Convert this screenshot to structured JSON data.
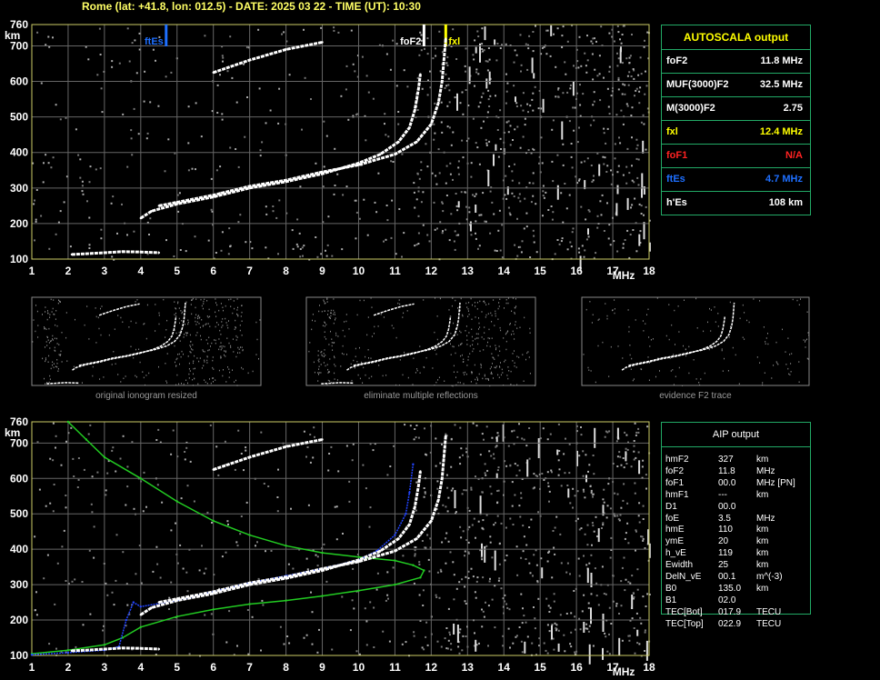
{
  "header": "Rome (lat: +41.8, lon: 012.5) - DATE: 2025 03 22 - TIME (UT): 10:30",
  "chart_data": [
    {
      "type": "scatter",
      "title": "",
      "xlabel": "MHz",
      "ylabel": "km",
      "xlim": [
        1,
        18
      ],
      "ylim": [
        100,
        760
      ],
      "xticks": [
        "1",
        "2",
        "3",
        "4",
        "5",
        "6",
        "7",
        "8",
        "9",
        "10",
        "11",
        "12",
        "13",
        "14",
        "15",
        "16",
        "17",
        "18"
      ],
      "yticks": [
        "100",
        "200",
        "300",
        "400",
        "500",
        "600",
        "700",
        "760"
      ],
      "grid": true,
      "markers": [
        {
          "name": "ftEs",
          "x": 4.7,
          "color": "#1e6fff"
        },
        {
          "name": "foF2",
          "x": 11.8,
          "color": "#ffffff"
        },
        {
          "name": "fxl",
          "x": 12.4,
          "color": "#ffff00"
        }
      ],
      "series": [
        {
          "points": [
            [
              4.0,
              215
            ],
            [
              4.3,
              235
            ],
            [
              5,
              255
            ],
            [
              6,
              275
            ],
            [
              7,
              300
            ],
            [
              8,
              318
            ],
            [
              9,
              340
            ],
            [
              10,
              370
            ],
            [
              10.6,
              395
            ],
            [
              11.1,
              430
            ],
            [
              11.4,
              470
            ],
            [
              11.55,
              520
            ],
            [
              11.65,
              580
            ],
            [
              11.7,
              620
            ]
          ]
        },
        {
          "points": [
            [
              4.5,
              250
            ],
            [
              5,
              260
            ],
            [
              6,
              280
            ],
            [
              7,
              305
            ],
            [
              8,
              322
            ],
            [
              9,
              345
            ],
            [
              10,
              365
            ],
            [
              11,
              395
            ],
            [
              11.6,
              430
            ],
            [
              12,
              480
            ],
            [
              12.2,
              540
            ],
            [
              12.3,
              600
            ],
            [
              12.35,
              660
            ],
            [
              12.4,
              720
            ]
          ]
        },
        {
          "points": [
            [
              2.1,
              113
            ],
            [
              2.5,
              115
            ],
            [
              3,
              118
            ],
            [
              3.5,
              121
            ],
            [
              4,
              120
            ],
            [
              4.5,
              118
            ]
          ]
        },
        {
          "points": [
            [
              6,
              625
            ],
            [
              7,
              660
            ],
            [
              8,
              690
            ],
            [
              9,
              710
            ]
          ]
        }
      ]
    },
    {
      "type": "line",
      "title": "",
      "xlabel": "MHz",
      "ylabel": "km",
      "xlim": [
        1,
        18
      ],
      "ylim": [
        100,
        760
      ],
      "xticks": [
        "1",
        "2",
        "3",
        "4",
        "5",
        "6",
        "7",
        "8",
        "9",
        "10",
        "11",
        "12",
        "13",
        "14",
        "15",
        "16",
        "17",
        "18"
      ],
      "yticks": [
        "100",
        "200",
        "300",
        "400",
        "500",
        "600",
        "700",
        "760"
      ],
      "grid": true,
      "series": [
        {
          "color": "#22cc22",
          "points": [
            [
              2.0,
              760
            ],
            [
              2.5,
              710
            ],
            [
              3,
              660
            ],
            [
              4,
              600
            ],
            [
              5,
              535
            ],
            [
              6,
              480
            ],
            [
              7,
              440
            ],
            [
              8,
              410
            ],
            [
              9,
              390
            ],
            [
              10,
              378
            ],
            [
              11,
              368
            ],
            [
              11.5,
              355
            ],
            [
              11.8,
              340
            ],
            [
              11.7,
              320
            ],
            [
              11,
              300
            ],
            [
              10,
              283
            ],
            [
              9,
              268
            ],
            [
              8,
              255
            ],
            [
              7,
              245
            ],
            [
              6,
              230
            ],
            [
              5,
              210
            ],
            [
              4,
              180
            ],
            [
              3.5,
              150
            ],
            [
              3,
              130
            ],
            [
              2,
              115
            ],
            [
              1,
              105
            ]
          ]
        },
        {
          "color": "#2244ff",
          "points": [
            [
              1,
              102
            ],
            [
              2,
              108
            ],
            [
              3.0,
              115
            ],
            [
              3.4,
              125
            ],
            [
              3.6,
              200
            ],
            [
              3.8,
              250
            ],
            [
              4,
              238
            ],
            [
              5,
              255
            ],
            [
              6,
              280
            ],
            [
              7,
              305
            ],
            [
              8,
              325
            ],
            [
              9,
              345
            ],
            [
              10,
              370
            ],
            [
              10.5,
              395
            ],
            [
              11,
              440
            ],
            [
              11.3,
              500
            ],
            [
              11.4,
              560
            ],
            [
              11.5,
              640
            ]
          ]
        },
        {
          "color": "#ffffff",
          "points": [
            [
              4.0,
              215
            ],
            [
              4.3,
              235
            ],
            [
              5,
              255
            ],
            [
              6,
              275
            ],
            [
              7,
              300
            ],
            [
              8,
              318
            ],
            [
              9,
              340
            ],
            [
              10,
              370
            ],
            [
              10.6,
              395
            ],
            [
              11.1,
              430
            ],
            [
              11.4,
              470
            ],
            [
              11.55,
              520
            ],
            [
              11.65,
              580
            ],
            [
              11.7,
              620
            ]
          ]
        },
        {
          "color": "#ffffff",
          "points": [
            [
              4.5,
              250
            ],
            [
              5,
              260
            ],
            [
              6,
              280
            ],
            [
              7,
              305
            ],
            [
              8,
              322
            ],
            [
              9,
              345
            ],
            [
              10,
              365
            ],
            [
              11,
              395
            ],
            [
              11.6,
              430
            ],
            [
              12,
              480
            ],
            [
              12.2,
              540
            ],
            [
              12.3,
              600
            ],
            [
              12.35,
              660
            ],
            [
              12.4,
              720
            ]
          ]
        },
        {
          "color": "#ffffff",
          "points": [
            [
              2.1,
              113
            ],
            [
              2.5,
              115
            ],
            [
              3,
              118
            ],
            [
              3.5,
              121
            ],
            [
              4,
              120
            ],
            [
              4.5,
              118
            ]
          ]
        },
        {
          "color": "#ffffff",
          "points": [
            [
              6,
              625
            ],
            [
              7,
              660
            ],
            [
              8,
              690
            ],
            [
              9,
              710
            ]
          ]
        }
      ]
    }
  ],
  "autoscala": {
    "title": "AUTOSCALA output",
    "rows": [
      {
        "k": "foF2",
        "v": "11.8 MHz",
        "color": "#ffffff"
      },
      {
        "k": "MUF(3000)F2",
        "v": "32.5 MHz",
        "color": "#ffffff"
      },
      {
        "k": "M(3000)F2",
        "v": "2.75",
        "color": "#ffffff"
      },
      {
        "k": "fxl",
        "v": "12.4 MHz",
        "color": "#ffff00"
      },
      {
        "k": "foF1",
        "v": "N/A",
        "color": "#ff2222"
      },
      {
        "k": "ftEs",
        "v": "4.7 MHz",
        "color": "#1e6fff"
      },
      {
        "k": "h'Es",
        "v": "108     km",
        "color": "#ffffff"
      }
    ]
  },
  "thumbs": [
    {
      "caption": "original ionogram resized"
    },
    {
      "caption": "eliminate multiple reflections"
    },
    {
      "caption": "evidence F2 trace"
    }
  ],
  "aip": {
    "title": "AIP output",
    "rows": [
      {
        "k": "hmF2",
        "v": "327",
        "u": "km"
      },
      {
        "k": "foF2",
        "v": "11.8",
        "u": "MHz"
      },
      {
        "k": "foF1",
        "v": "00.0",
        "u": "MHz   [PN]"
      },
      {
        "k": "hmF1",
        "v": "---",
        "u": "km"
      },
      {
        "k": "D1",
        "v": "00.0",
        "u": ""
      },
      {
        "k": "foE",
        "v": "3.5",
        "u": "MHz"
      },
      {
        "k": "hmE",
        "v": "110",
        "u": "km"
      },
      {
        "k": "ymE",
        "v": "20",
        "u": "km"
      },
      {
        "k": "h_vE",
        "v": "119",
        "u": "km"
      },
      {
        "k": "Ewidth",
        "v": "25",
        "u": "km"
      },
      {
        "k": "DelN_vE",
        "v": "00.1",
        "u": "m^(-3)"
      },
      {
        "k": "B0",
        "v": "135.0",
        "u": "km"
      },
      {
        "k": "B1",
        "v": "02.0",
        "u": ""
      },
      {
        "k": "TEC[Bot]",
        "v": "017.9",
        "u": "TECU"
      },
      {
        "k": "TEC[Top]",
        "v": "022.9",
        "u": "TECU"
      }
    ]
  }
}
